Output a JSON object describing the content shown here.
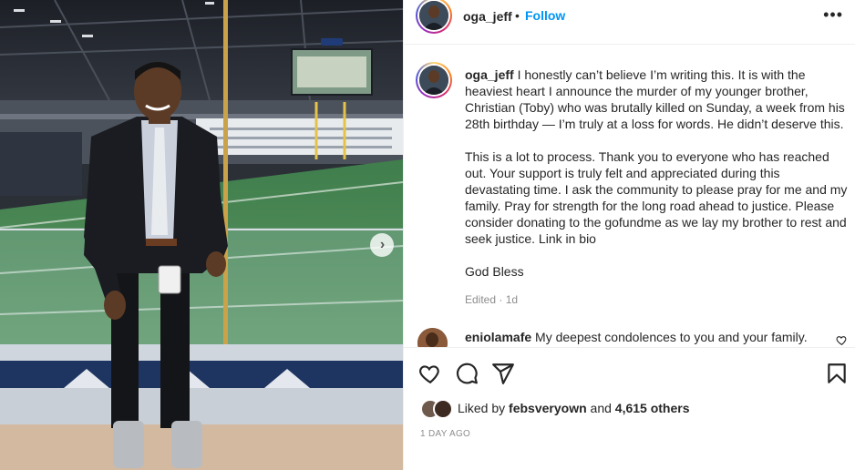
{
  "post": {
    "author": "oga_jeff",
    "dot": "•",
    "follow_label": "Follow",
    "more_label": "•••",
    "caption_paragraphs": [
      "I honestly can’t believe I’m writing this. It is with the heaviest heart I announce the murder of my younger brother, Christian (Toby) who was brutally killed on Sunday, a week from his 28th birthday — I’m truly at a loss for words. He didn’t deserve this.",
      "This is a lot to process. Thank you to everyone who has reached out. Your support is truly felt and appreciated during this devastating time. I ask the community to please pray for me and my family. Pray for strength for the long road ahead to justice. Please consider donating to the gofundme as we lay my brother to rest and seek justice. Link in bio",
      "God Bless"
    ],
    "edited_label": "Edited · 1d",
    "time_label": "1 DAY AGO"
  },
  "comment": {
    "author": "eniolamafe",
    "text": "My deepest condolences to you and your family."
  },
  "likes": {
    "prefix": "Liked by",
    "user": "febsveryown",
    "joiner": "and",
    "count": "4,615 others"
  },
  "icons": {
    "heart": "heart-icon",
    "comment": "comment-icon",
    "share": "share-icon",
    "save": "bookmark-icon",
    "next": "chevron-right-icon",
    "more": "more-horizontal-icon"
  },
  "colors": {
    "link_blue": "#0095f6",
    "muted": "#8e8e8e",
    "text": "#262626"
  }
}
